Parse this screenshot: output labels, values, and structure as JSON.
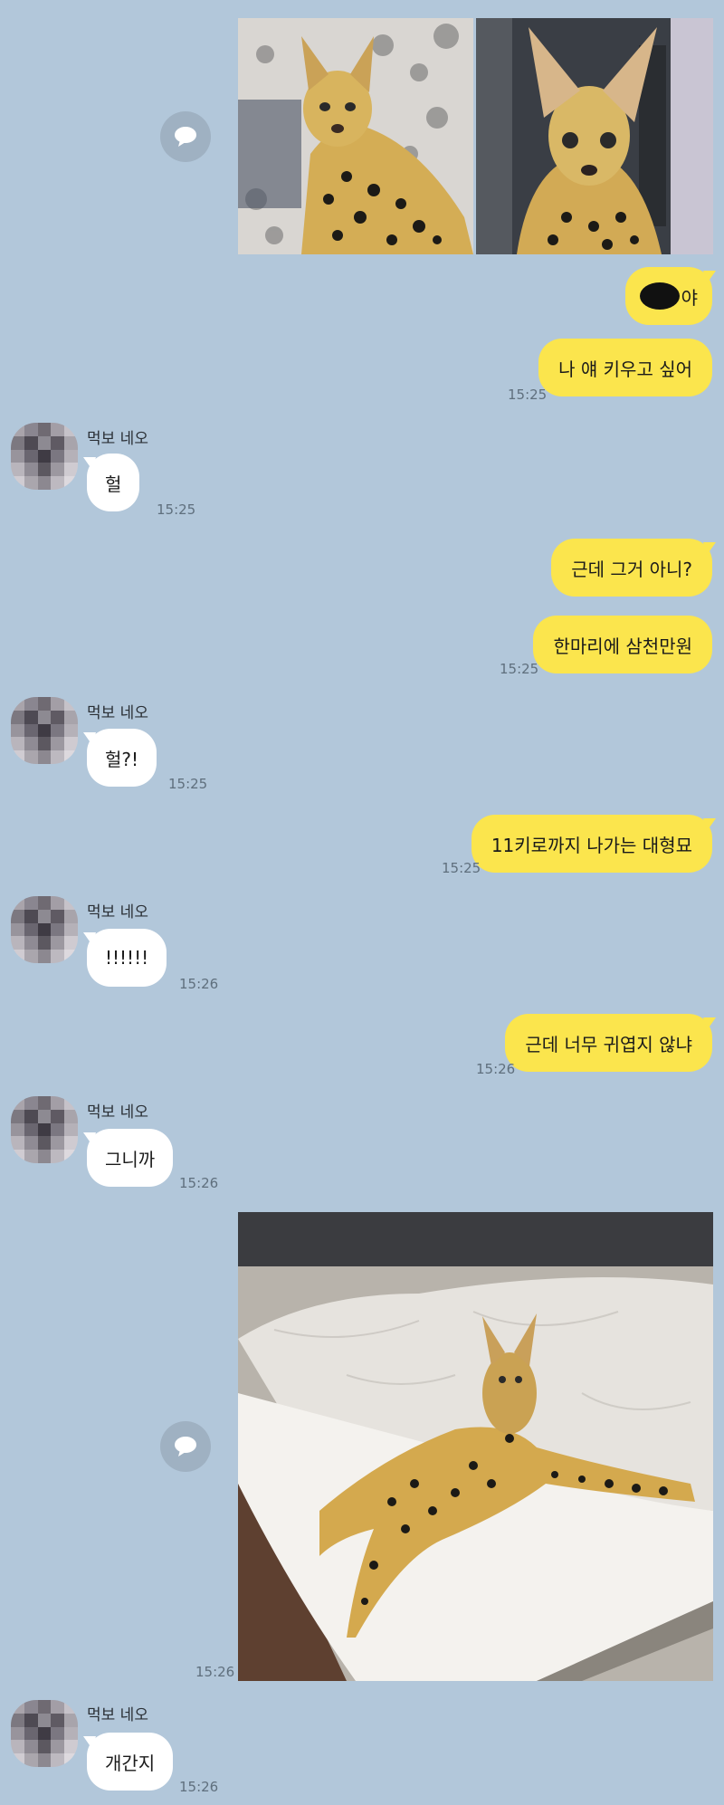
{
  "contact": {
    "name": "먹보 네오"
  },
  "messages": {
    "m1_name": "야",
    "m2": "나 얘 키우고 싶어",
    "m2_time": "15:25",
    "r1": "헐",
    "r1_time": "15:25",
    "m3": "근데 그거 아니?",
    "m4": "한마리에 삼천만원",
    "m4_time": "15:25",
    "r2": "헐?!",
    "r2_time": "15:25",
    "m5": "11키로까지 나가는 대형묘",
    "m5_time": "15:25",
    "r3": "!!!!!!",
    "r3_time": "15:26",
    "m6": "근데 너무 귀엽지 않냐",
    "m6_time": "15:26",
    "r4": "그니까",
    "r4_time": "15:26",
    "photo_time": "15:26",
    "r5": "개간지",
    "r5_time": "15:26"
  },
  "colors": {
    "background": "#b2c7da",
    "my_bubble": "#fbe54d",
    "their_bubble": "#ffffff"
  },
  "icons": {
    "share": "speech-bubble-icon"
  }
}
